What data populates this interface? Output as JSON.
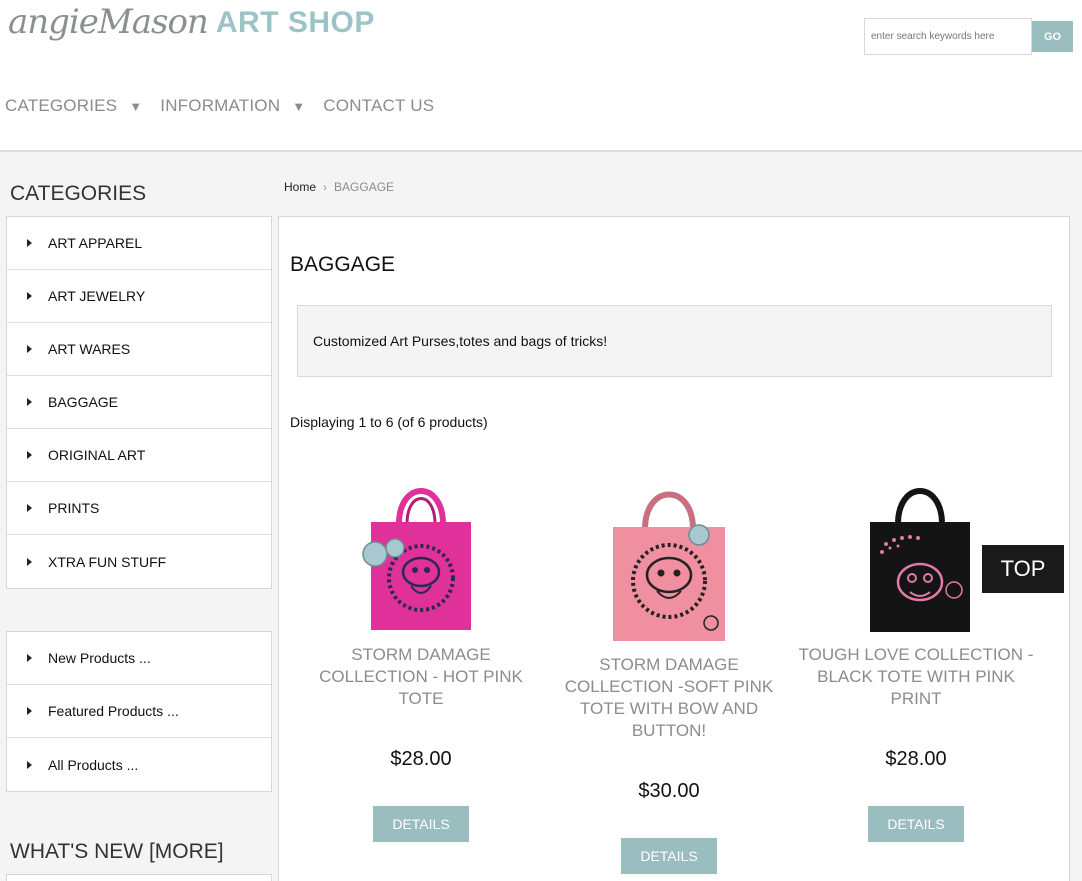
{
  "header": {
    "logo_script": "angieMason",
    "logo_shop": "ART SHOP",
    "search_placeholder": "enter search keywords here",
    "search_button": "GO"
  },
  "nav": {
    "items": [
      {
        "label": "CATEGORIES",
        "has_dropdown": true
      },
      {
        "label": "INFORMATION",
        "has_dropdown": true
      },
      {
        "label": "CONTACT US",
        "has_dropdown": false
      }
    ],
    "dropdown_glyph": "▼"
  },
  "sidebar": {
    "categories_title": "CATEGORIES",
    "categories": [
      "ART APPAREL",
      "ART JEWELRY",
      "ART WARES",
      "BAGGAGE",
      "ORIGINAL ART",
      "PRINTS",
      "XTRA FUN STUFF"
    ],
    "product_links": [
      "New Products ...",
      "Featured Products ...",
      "All Products ..."
    ],
    "whats_new_title": "WHAT'S NEW  [MORE]"
  },
  "breadcrumb": {
    "home": "Home",
    "separator": "›",
    "current": "BAGGAGE"
  },
  "main": {
    "title": "BAGGAGE",
    "description": "Customized Art Purses,totes and bags of tricks!",
    "displaying": "Displaying 1 to 6 (of 6 products)"
  },
  "products": [
    {
      "name": "STORM DAMAGE COLLECTION - HOT PINK TOTE",
      "price": "$28.00",
      "button": "DETAILS",
      "bag_color": "#e0309a",
      "print_color": "#2a2a4a"
    },
    {
      "name": "STORM DAMAGE COLLECTION -SOFT PINK TOTE WITH BOW AND BUTTON!",
      "price": "$30.00",
      "button": "DETAILS",
      "bag_color": "#f08fa0",
      "print_color": "#222222"
    },
    {
      "name": "TOUGH LOVE COLLECTION - BLACK TOTE WITH PINK PRINT",
      "price": "$28.00",
      "button": "DETAILS",
      "bag_color": "#141414",
      "print_color": "#e07aa8"
    }
  ],
  "back_to_top": "TOP",
  "colors": {
    "accent": "#9abdbf",
    "logo_shop": "#9cc4c7",
    "nav_text": "#8c8c8c",
    "page_bg": "#f4f4f4"
  }
}
